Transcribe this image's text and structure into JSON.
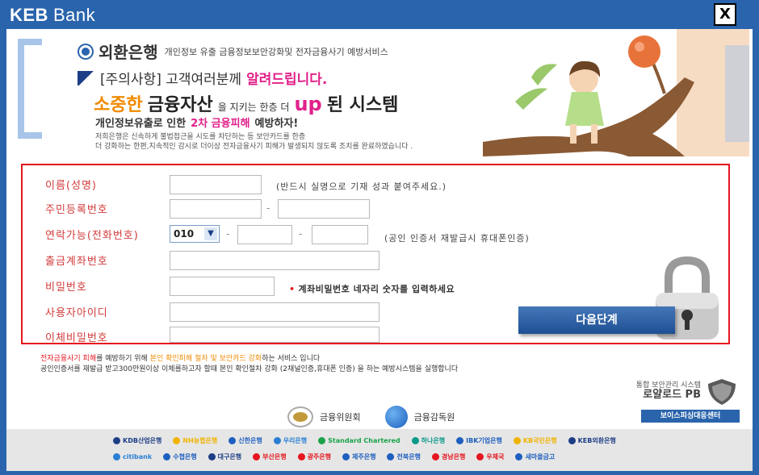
{
  "window": {
    "logo_primary": "KEB",
    "logo_secondary": "Bank",
    "close_label": "X"
  },
  "banner": {
    "bank_name": "외환은행",
    "bank_subtitle": "개인정보 유출 금융정보보안강화및 전자금융사기 예방서비스",
    "notice_prefix": "[주의사항] 고객여러분께",
    "notice_highlight": "알려드립니다.",
    "headline_orange": "소중한",
    "headline_dark": "금융자산",
    "headline_small": "을 지키는 한층 더",
    "headline_up": "up",
    "headline_end": "된 시스템",
    "subline_a": "개인정보유출로 인한",
    "subline_red": "2차 금융피해",
    "subline_b": "예방하자!",
    "small_line1": "저희은행은 신속하게 불법접근을 시도를 차단하는 등 보안카드를 한층",
    "small_line2": "더 강화하는 한편,지속적인 감시로 더이상 전자금융사기 피해가 발생되지 않도록 조치를 완료하였습니다 ."
  },
  "form": {
    "name_label": "이름(성명)",
    "name_note": "(반드시 실명으로 기재 성과 붙여주세요.)",
    "rrn_label": "주민등록번호",
    "phone_label": "연락가능(전화번호)",
    "phone_prefix": "010",
    "phone_note": "(공인 인증서 재발급시 휴대폰인증)",
    "account_label": "출금계좌번호",
    "password_label": "비밀번호",
    "password_note": "계좌비밀번호 네자리 숫자를 입력하세요",
    "userid_label": "사용자아이디",
    "transfer_pw_label": "이체비밀번호",
    "next_button": "다음단계",
    "dash": "-"
  },
  "info": {
    "line1_red": "전자금융사기 피해",
    "line1_a": "를 예방하기 위해",
    "line1_orange": "본인 확인피해 절차 및 보안카드 강화",
    "line1_b": "하는 서비스 입니다",
    "line2": "공인인증서를 재발급 받고300만원이상 이체를하고자 할때 본인 확인절차 강화 (2채널인증,휴대폰 인증) 을 하는 예방시스템을 실행합니다"
  },
  "security": {
    "line1": "통합 보안관리 시스템",
    "line2": "로얄로드 PB",
    "button": "보이스피싱대응센터"
  },
  "agencies": [
    {
      "name": "금융위원회"
    },
    {
      "name": "금융감독원"
    }
  ],
  "partners_row1": [
    {
      "name": "KDB산업은행",
      "color": "#1d3e86"
    },
    {
      "name": "NH농협은행",
      "color": "#f0b400"
    },
    {
      "name": "신한은행",
      "color": "#1d5fbf"
    },
    {
      "name": "우리은행",
      "color": "#2a7fd4"
    },
    {
      "name": "Standard Chartered",
      "color": "#1aa34a"
    },
    {
      "name": "하나은행",
      "color": "#0a9a8a"
    },
    {
      "name": "IBK기업은행",
      "color": "#1d5fbf"
    },
    {
      "name": "KB국민은행",
      "color": "#f0b400"
    },
    {
      "name": "KEB외환은행",
      "color": "#1d3e86"
    }
  ],
  "partners_row2": [
    {
      "name": "citibank",
      "color": "#2a7fd4"
    },
    {
      "name": "수협은행",
      "color": "#1d5fbf"
    },
    {
      "name": "대구은행",
      "color": "#1d3e86"
    },
    {
      "name": "부산은행",
      "color": "#e5161f"
    },
    {
      "name": "광주은행",
      "color": "#e5161f"
    },
    {
      "name": "제주은행",
      "color": "#1d5fbf"
    },
    {
      "name": "전북은행",
      "color": "#1d5fbf"
    },
    {
      "name": "경남은행",
      "color": "#e5161f"
    },
    {
      "name": "우체국",
      "color": "#e5161f"
    },
    {
      "name": "새마을금고",
      "color": "#1d5fbf"
    }
  ]
}
